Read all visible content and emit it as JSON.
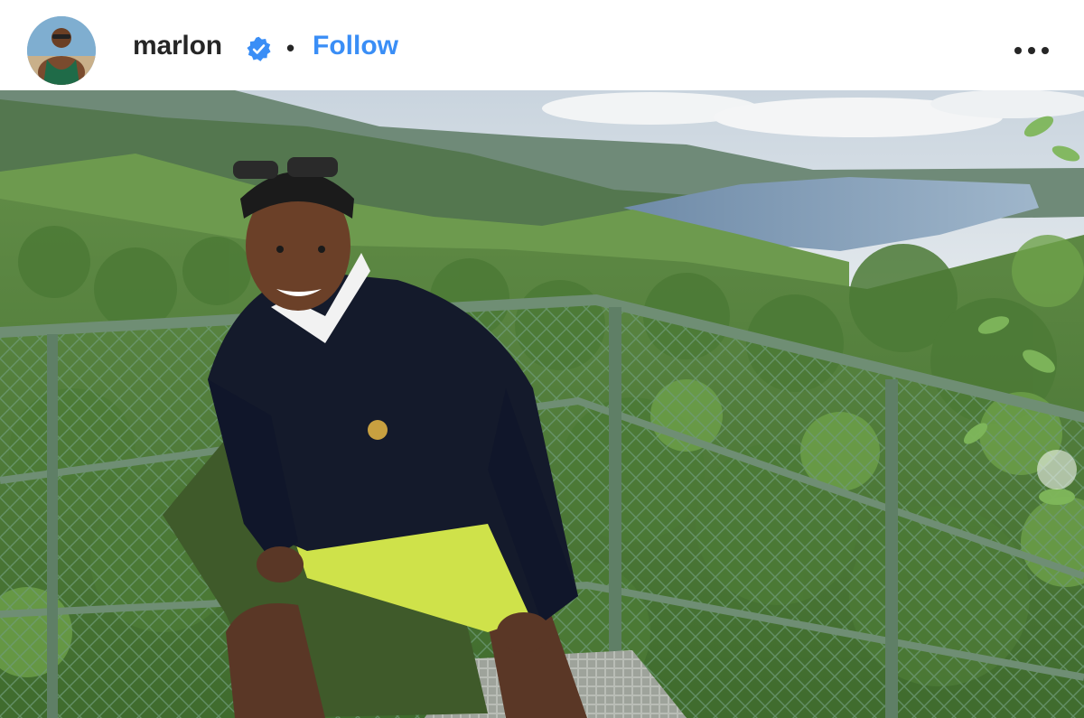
{
  "post": {
    "username": "marlon",
    "verified_icon": "verified-badge-icon",
    "separator": "•",
    "follow_label": "Follow",
    "more_icon": "more-options-icon",
    "avatar_icon": "profile-avatar",
    "image_icon": "post-photo",
    "carousel_icon": "carousel-next-indicator"
  },
  "colors": {
    "follow": "#3a8ef6",
    "verified": "#3a8ef6",
    "text": "#262626"
  }
}
